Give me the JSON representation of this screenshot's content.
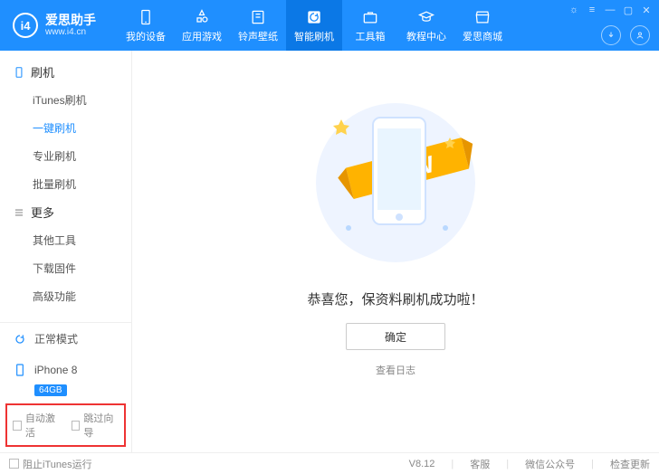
{
  "brand": {
    "name": "爱思助手",
    "url": "www.i4.cn",
    "logo": "i4"
  },
  "nav": [
    {
      "id": "device",
      "label": "我的设备"
    },
    {
      "id": "apps",
      "label": "应用游戏"
    },
    {
      "id": "ring",
      "label": "铃声壁纸"
    },
    {
      "id": "flash",
      "label": "智能刷机",
      "active": true
    },
    {
      "id": "toolbox",
      "label": "工具箱"
    },
    {
      "id": "tutorial",
      "label": "教程中心"
    },
    {
      "id": "mall",
      "label": "爱思商城"
    }
  ],
  "sidebar": {
    "groups": [
      {
        "title": "刷机",
        "items": [
          {
            "id": "itunes",
            "label": "iTunes刷机"
          },
          {
            "id": "oneclick",
            "label": "一键刷机",
            "active": true
          },
          {
            "id": "pro",
            "label": "专业刷机"
          },
          {
            "id": "batch",
            "label": "批量刷机"
          }
        ]
      },
      {
        "title": "更多",
        "items": [
          {
            "id": "other",
            "label": "其他工具"
          },
          {
            "id": "fw",
            "label": "下载固件"
          },
          {
            "id": "adv",
            "label": "高级功能"
          }
        ]
      }
    ],
    "mode": "正常模式",
    "device": {
      "name": "iPhone 8",
      "cap": "64GB"
    },
    "options": {
      "auto": "自动激活",
      "skip": "跳过向导"
    }
  },
  "main": {
    "banner": "NEW",
    "message": "恭喜您，保资料刷机成功啦！",
    "confirm": "确定",
    "log": "查看日志"
  },
  "footer": {
    "block": "阻止iTunes运行",
    "ver": "V8.12",
    "svc": "客服",
    "wx": "微信公众号",
    "upd": "检查更新"
  }
}
